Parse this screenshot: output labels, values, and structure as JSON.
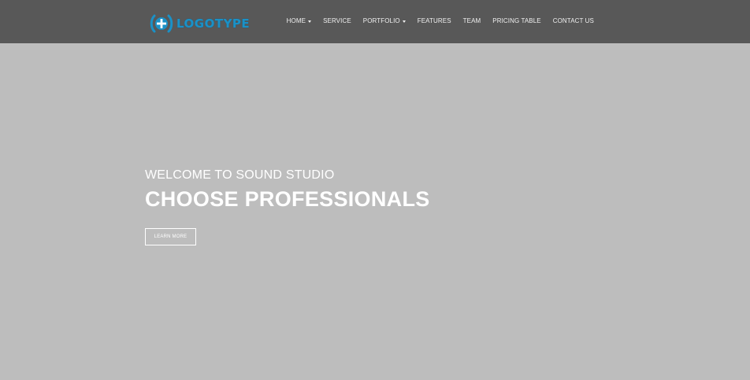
{
  "header": {
    "logo": {
      "text": "LOGOTYPE",
      "icon": "sound-logo-icon",
      "color": "#1a91c7"
    },
    "nav_items": [
      {
        "label": "HOME",
        "has_dropdown": true
      },
      {
        "label": "SERVICE",
        "has_dropdown": false
      },
      {
        "label": "PORTFOLIO",
        "has_dropdown": true
      },
      {
        "label": "FEATURES",
        "has_dropdown": false
      },
      {
        "label": "TEAM",
        "has_dropdown": false
      },
      {
        "label": "PRICING TABLE",
        "has_dropdown": false
      },
      {
        "label": "CONTACT US",
        "has_dropdown": false
      }
    ],
    "background_color": "#585858"
  },
  "hero": {
    "subtitle": "WELCOME TO SOUND STUDIO",
    "title": "CHOOSE PROFESSIONALS",
    "button_label": "LEARN MORE",
    "background_color": "#bdbdbd"
  }
}
